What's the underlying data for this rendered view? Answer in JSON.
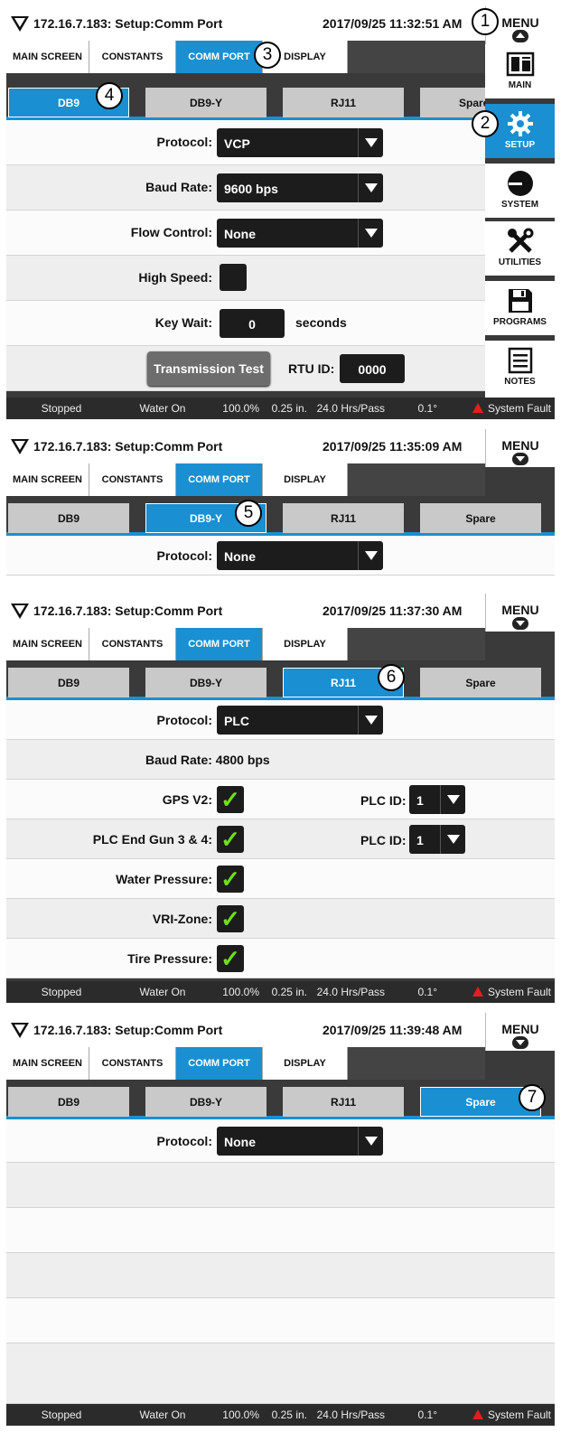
{
  "app": {
    "title": "172.16.7.183: Setup:Comm Port",
    "menu_label": "MENU",
    "nav_tabs": [
      "MAIN SCREEN",
      "CONSTANTS",
      "COMM PORT",
      "DISPLAY"
    ],
    "sub_tabs": [
      "DB9",
      "DB9-Y",
      "RJ11",
      "Spare"
    ],
    "status_bar": {
      "state": "Stopped",
      "water": "Water On",
      "percent": "100.0%",
      "depth": "0.25 in.",
      "hrs": "24.0 Hrs/Pass",
      "angle": "0.1°",
      "fault": "System Fault"
    }
  },
  "sidebar": {
    "items": [
      {
        "label": "MAIN",
        "icon": "main-display-icon"
      },
      {
        "label": "SETUP",
        "icon": "gear-icon"
      },
      {
        "label": "SYSTEM",
        "icon": "system-gauge-icon"
      },
      {
        "label": "UTILITIES",
        "icon": "tools-icon"
      },
      {
        "label": "PROGRAMS",
        "icon": "save-disk-icon"
      },
      {
        "label": "NOTES",
        "icon": "notes-icon"
      }
    ]
  },
  "panels": [
    {
      "datetime": "2017/09/25 11:32:51 AM",
      "active_sub_tab": "DB9",
      "protocol_label": "Protocol:",
      "protocol_value": "VCP",
      "baud_label": "Baud Rate:",
      "baud_value": "9600 bps",
      "flow_label": "Flow Control:",
      "flow_value": "None",
      "highspeed_label": "High Speed:",
      "highspeed_checked": false,
      "keywait_label": "Key Wait:",
      "keywait_value": "0",
      "keywait_unit": "seconds",
      "test_button": "Transmission Test",
      "rtu_label": "RTU ID:",
      "rtu_value": "0000"
    },
    {
      "datetime": "2017/09/25 11:35:09 AM",
      "active_sub_tab": "DB9-Y",
      "protocol_label": "Protocol:",
      "protocol_value": "None"
    },
    {
      "datetime": "2017/09/25 11:37:30 AM",
      "active_sub_tab": "RJ11",
      "protocol_label": "Protocol:",
      "protocol_value": "PLC",
      "baud_text": "Baud Rate:  4800 bps",
      "gps_label": "GPS V2:",
      "gps_checked": true,
      "plc_id_label": "PLC ID:",
      "plc_id_value": "1",
      "endgun_label": "PLC End Gun 3 & 4:",
      "endgun_checked": true,
      "plc_id2_label": "PLC ID:",
      "plc_id2_value": "1",
      "water_pressure_label": "Water Pressure:",
      "water_pressure_checked": true,
      "vri_label": "VRI-Zone:",
      "vri_checked": true,
      "tire_label": "Tire Pressure:",
      "tire_checked": true
    },
    {
      "datetime": "2017/09/25 11:39:48 AM",
      "active_sub_tab": "Spare",
      "protocol_label": "Protocol:",
      "protocol_value": "None"
    }
  ],
  "callouts": [
    "1",
    "2",
    "3",
    "4",
    "5",
    "6",
    "7"
  ],
  "check_glyph": "✓",
  "colors": {
    "accent": "#1a8fd1",
    "frame": "#3a3a3a",
    "check": "#6ee012",
    "warning": "#e02020"
  }
}
